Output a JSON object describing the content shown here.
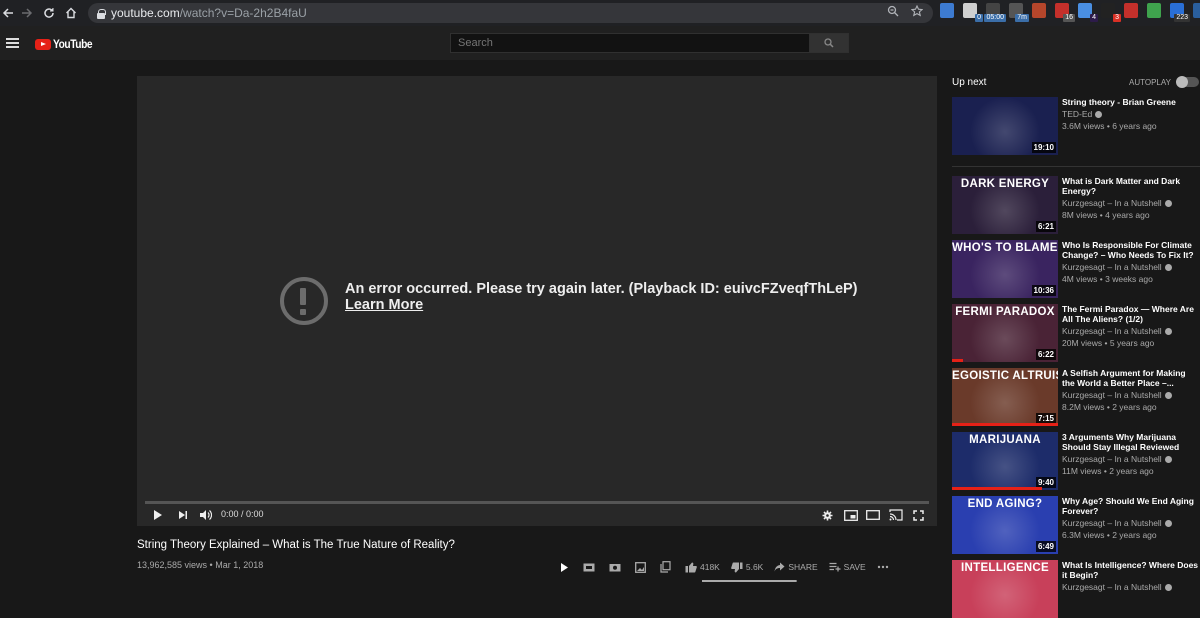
{
  "browser": {
    "url_host": "youtube.com",
    "url_path": "/watch?v=Da-2h2B4faU",
    "extensions": [
      {
        "name": "globe-extension",
        "color": "#3d7bd1",
        "badge": ""
      },
      {
        "name": "page-extension",
        "color": "#d0d0d0",
        "badge": "0",
        "badge_color": "#3b6ea8"
      },
      {
        "name": "timer-extension",
        "color": "#444",
        "badge": "05:00",
        "badge_color": "#3b6ea8"
      },
      {
        "name": "mouse-extension",
        "color": "#555",
        "badge": "7m",
        "badge_color": "#3b6ea8"
      },
      {
        "name": "book-extension",
        "color": "#b5462b",
        "badge": ""
      },
      {
        "name": "abp-extension",
        "color": "#c4302b",
        "badge": "16",
        "badge_color": "#555"
      },
      {
        "name": "ghost-extension",
        "color": "#4a8fe2",
        "badge": "4",
        "badge_color": "#2d1b4a"
      },
      {
        "name": "terminal-extension",
        "color": "#222",
        "badge": "3",
        "badge_color": "#d93025"
      },
      {
        "name": "dots-extension",
        "color": "#c4302b",
        "badge": ""
      },
      {
        "name": "pushbullet-extension",
        "color": "#3fa34d",
        "badge": ""
      },
      {
        "name": "counter-extension",
        "color": "#2a6fd6",
        "badge": "223",
        "badge_color": "#333"
      },
      {
        "name": "sh-extension",
        "color": "#2a5f9e",
        "badge": ""
      }
    ]
  },
  "header": {
    "logo_text": "YouTube",
    "search_placeholder": "Search"
  },
  "player": {
    "error_message": "An error occurred. Please try again later. (Playback ID: euivcFZveqfThLeP)",
    "learn_more": "Learn More",
    "time": "0:00 / 0:00"
  },
  "video": {
    "title": "String Theory Explained – What is The True Nature of Reality?",
    "meta": "13,962,585 views • Mar 1, 2018",
    "likes": "418K",
    "dislikes": "5.6K",
    "share_label": "SHARE",
    "save_label": "SAVE",
    "like_ratio": 0.987
  },
  "sidebar": {
    "up_next_label": "Up next",
    "autoplay_label": "AUTOPLAY",
    "autoplay_on": false,
    "recommendations": [
      {
        "thumb_text": "",
        "duration": "19:10",
        "title": "String theory - Brian Greene",
        "channel": "TED-Ed",
        "views": "3.6M views • 6 years ago",
        "watched": 0,
        "bg": "#1a2050"
      },
      {
        "thumb_text": "DARK ENERGY",
        "duration": "6:21",
        "title": "What is Dark Matter and Dark Energy?",
        "channel": "Kurzgesagt – In a Nutshell",
        "views": "8M views • 4 years ago",
        "watched": 0,
        "bg": "#2b1f3a"
      },
      {
        "thumb_text": "WHO'S TO BLAME?",
        "duration": "10:36",
        "title": "Who Is Responsible For Climate Change? – Who Needs To Fix It?",
        "channel": "Kurzgesagt – In a Nutshell",
        "views": "4M views • 3 weeks ago",
        "watched": 0,
        "bg": "#3a2460"
      },
      {
        "thumb_text": "FERMI PARADOX",
        "duration": "6:22",
        "title": "The Fermi Paradox — Where Are All The Aliens? (1/2)",
        "channel": "Kurzgesagt – In a Nutshell",
        "views": "20M views • 5 years ago",
        "watched": 0.1,
        "bg": "#4a2336"
      },
      {
        "thumb_text": "EGOISTIC ALTRUISM",
        "duration": "7:15",
        "title": "A Selfish Argument for Making the World a Better Place –...",
        "channel": "Kurzgesagt – In a Nutshell",
        "views": "8.2M views • 2 years ago",
        "watched": 1,
        "bg": "#6a3a2a"
      },
      {
        "thumb_text": "MARIJUANA",
        "duration": "9:40",
        "title": "3 Arguments Why Marijuana Should Stay Illegal Reviewed",
        "channel": "Kurzgesagt – In a Nutshell",
        "views": "11M views • 2 years ago",
        "watched": 0.85,
        "bg": "#1d2c6a"
      },
      {
        "thumb_text": "END AGING?",
        "duration": "6:49",
        "title": "Why Age? Should We End Aging Forever?",
        "channel": "Kurzgesagt – In a Nutshell",
        "views": "6.3M views • 2 years ago",
        "watched": 0,
        "bg": "#2a3fb0"
      },
      {
        "thumb_text": "INTELLIGENCE",
        "duration": "",
        "title": "What Is Intelligence? Where Does it Begin?",
        "channel": "Kurzgesagt – In a Nutshell",
        "views": "",
        "watched": 0,
        "bg": "#c8405a"
      }
    ]
  }
}
